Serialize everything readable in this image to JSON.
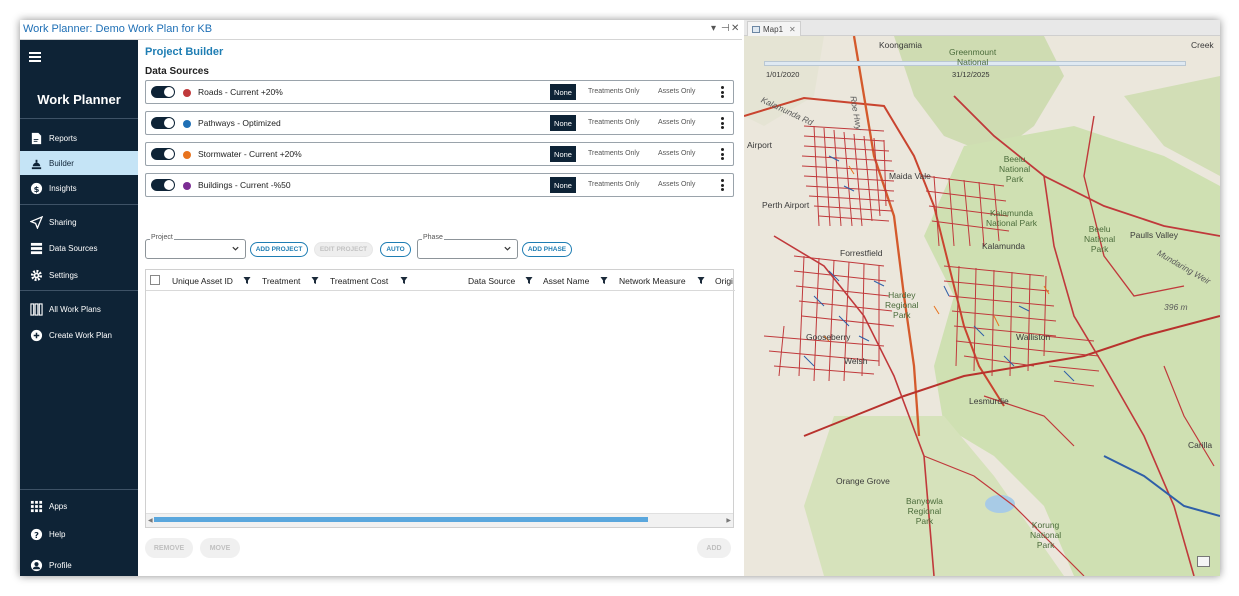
{
  "window": {
    "title": "Work Planner: Demo Work Plan for KB",
    "controls": {
      "dropdown": "▾",
      "pin": "⊣",
      "close": "✕"
    }
  },
  "sidebar": {
    "app_name": "Work Planner",
    "items": [
      {
        "label": "Reports",
        "icon": "report-icon"
      },
      {
        "label": "Builder",
        "icon": "builder-icon",
        "active": true
      },
      {
        "label": "Insights",
        "icon": "dollar-icon"
      },
      {
        "label": "Sharing",
        "icon": "send-icon"
      },
      {
        "label": "Data Sources",
        "icon": "database-icon"
      },
      {
        "label": "Settings",
        "icon": "gear-icon"
      },
      {
        "label": "All Work Plans",
        "icon": "columns-icon"
      },
      {
        "label": "Create Work Plan",
        "icon": "plus-circle-icon"
      }
    ],
    "bottom_items": [
      {
        "label": "Apps",
        "icon": "grid-icon"
      },
      {
        "label": "Help",
        "icon": "help-icon"
      },
      {
        "label": "Profile",
        "icon": "profile-icon"
      }
    ]
  },
  "builder": {
    "title": "Project Builder",
    "data_sources_title": "Data Sources",
    "data_sources": [
      {
        "name": "Roads - Current +20%",
        "color": "#c0393b"
      },
      {
        "name": "Pathways - Optimized",
        "color": "#1f6fb5"
      },
      {
        "name": "Stormwater - Current +20%",
        "color": "#e8731e"
      },
      {
        "name": "Buildings - Current -%50",
        "color": "#7b2d93"
      }
    ],
    "filter_options": {
      "none": "None",
      "treatments_only": "Treatments Only",
      "assets_only": "Assets Only"
    },
    "project_label": "Project",
    "phase_label": "Phase",
    "buttons": {
      "add_project": "ADD PROJECT",
      "edit_project": "EDIT PROJECT",
      "auto": "AUTO",
      "add_phase": "ADD PHASE",
      "remove": "REMOVE",
      "move": "MOVE",
      "add": "ADD"
    },
    "columns": [
      "Unique Asset ID",
      "Treatment",
      "Treatment Cost",
      "Data Source",
      "Asset Name",
      "Network Measure",
      "Origi"
    ]
  },
  "map": {
    "tab_label": "Map1",
    "time_start": "1/01/2020",
    "time_end": "31/12/2025",
    "labels": {
      "koongamia": "Koongamia",
      "greenmount": "Greenmount\nNational",
      "creek": "Creek",
      "kalamunda_rd": "Kalamunda Rd",
      "roe_hwy": "Roe Hwy",
      "airport": "Airport",
      "perth_airport": "Perth Airport",
      "beelu": "Beelu\nNational\nPark",
      "kalamunda_np": "Kalamunda\nNational Park",
      "beelu2": "Beelu\nNational\nPark",
      "paulls": "Paulls Valley",
      "mundaring": "Mundaring Weir",
      "kalamunda": "Kalamunda",
      "hardey": "Hardey\nRegional\nPark",
      "elevation": "396 m",
      "lesmurdie": "Lesmurdie",
      "orange_grove": "Orange Grove",
      "banyowla": "Banyowla\nRegional\nPark",
      "korung": "Korung\nNational\nPark",
      "carilla": "Carilla",
      "welsh": "Welsh",
      "gooseberry": "Gooseberry",
      "maida_vale": "Maida Vale",
      "forrestfield": "Forrestfield",
      "walliston": "Walliston"
    }
  }
}
